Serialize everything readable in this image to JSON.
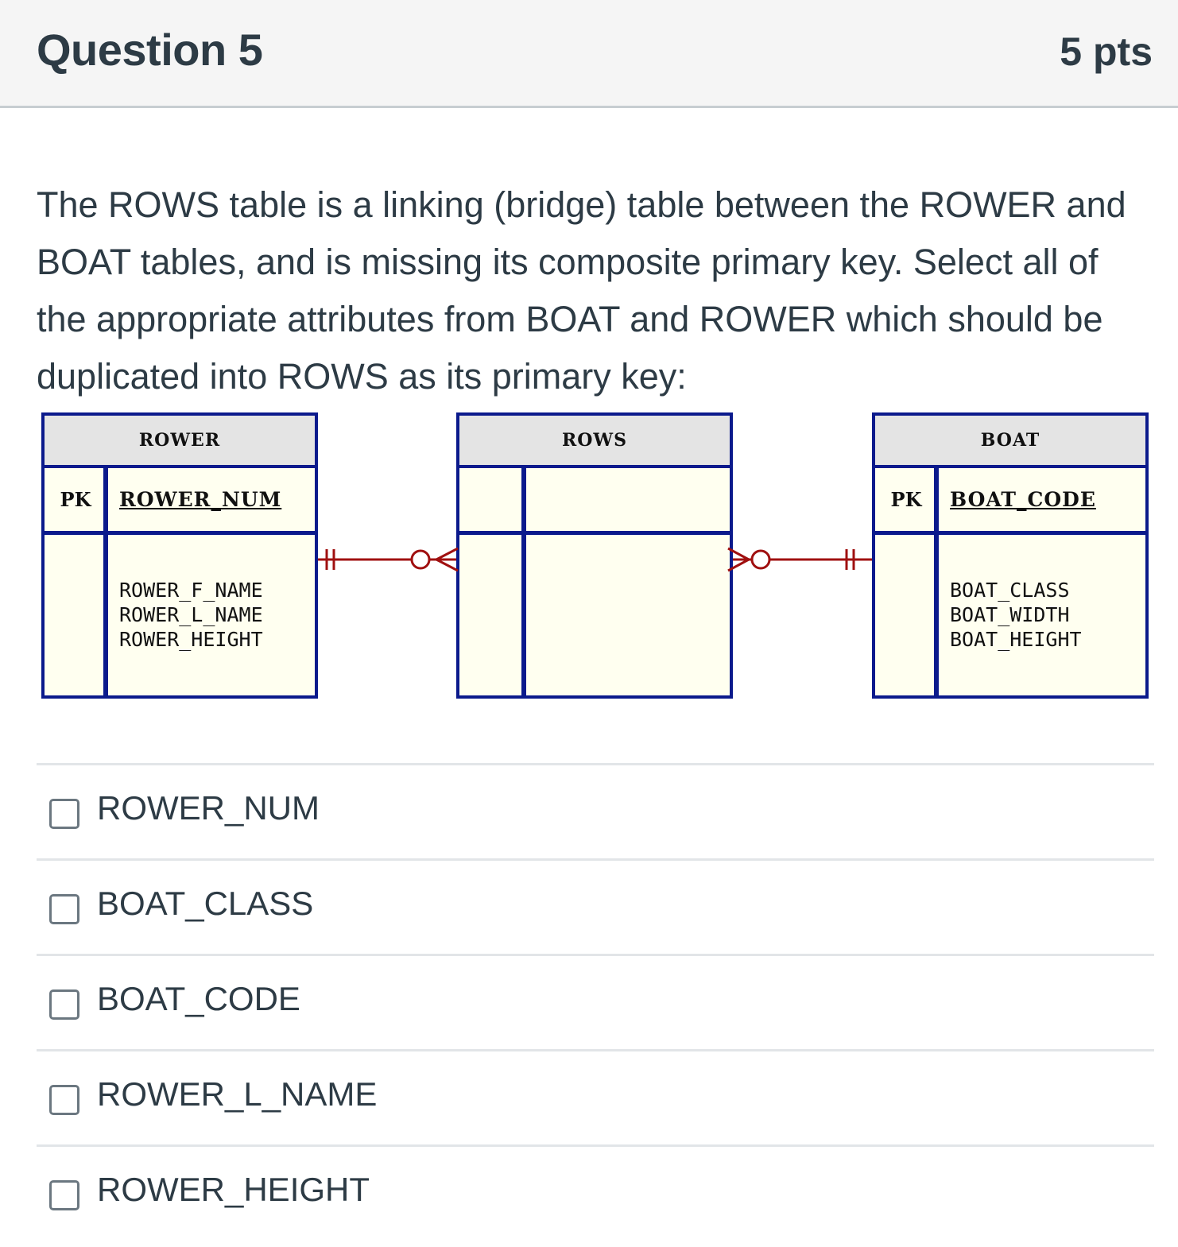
{
  "question": {
    "title": "Question 5",
    "points": "5 pts",
    "text": "The ROWS table is a linking (bridge) table between the ROWER and BOAT tables, and is missing its composite primary key. Select all of the appropriate attributes from BOAT and ROWER which should be duplicated into ROWS as its primary key:"
  },
  "diagram": {
    "colors": {
      "border": "#0b1a8c",
      "header_bg": "#e4e4e4",
      "body_bg": "#fffff0",
      "relationship": "#a01010"
    },
    "entities": [
      {
        "name": "ROWER",
        "pk_label": "PK",
        "pk_attribute": "ROWER_NUM",
        "attributes": [
          "ROWER_F_NAME",
          "ROWER_L_NAME",
          "ROWER_HEIGHT"
        ]
      },
      {
        "name": "ROWS",
        "pk_label": "",
        "pk_attribute": "",
        "attributes": []
      },
      {
        "name": "BOAT",
        "pk_label": "PK",
        "pk_attribute": "BOAT_CODE",
        "attributes": [
          "BOAT_CLASS",
          "BOAT_WIDTH",
          "BOAT_HEIGHT"
        ]
      }
    ],
    "relationships": [
      {
        "from": "ROWER",
        "to": "ROWS",
        "from_cardinality": "one-and-only-one",
        "to_cardinality": "zero-or-many"
      },
      {
        "from": "BOAT",
        "to": "ROWS",
        "from_cardinality": "one-and-only-one",
        "to_cardinality": "zero-or-many"
      }
    ]
  },
  "answers": [
    {
      "label": "ROWER_NUM",
      "checked": false
    },
    {
      "label": "BOAT_CLASS",
      "checked": false
    },
    {
      "label": "BOAT_CODE",
      "checked": false
    },
    {
      "label": "ROWER_L_NAME",
      "checked": false
    },
    {
      "label": "ROWER_HEIGHT",
      "checked": false
    }
  ]
}
